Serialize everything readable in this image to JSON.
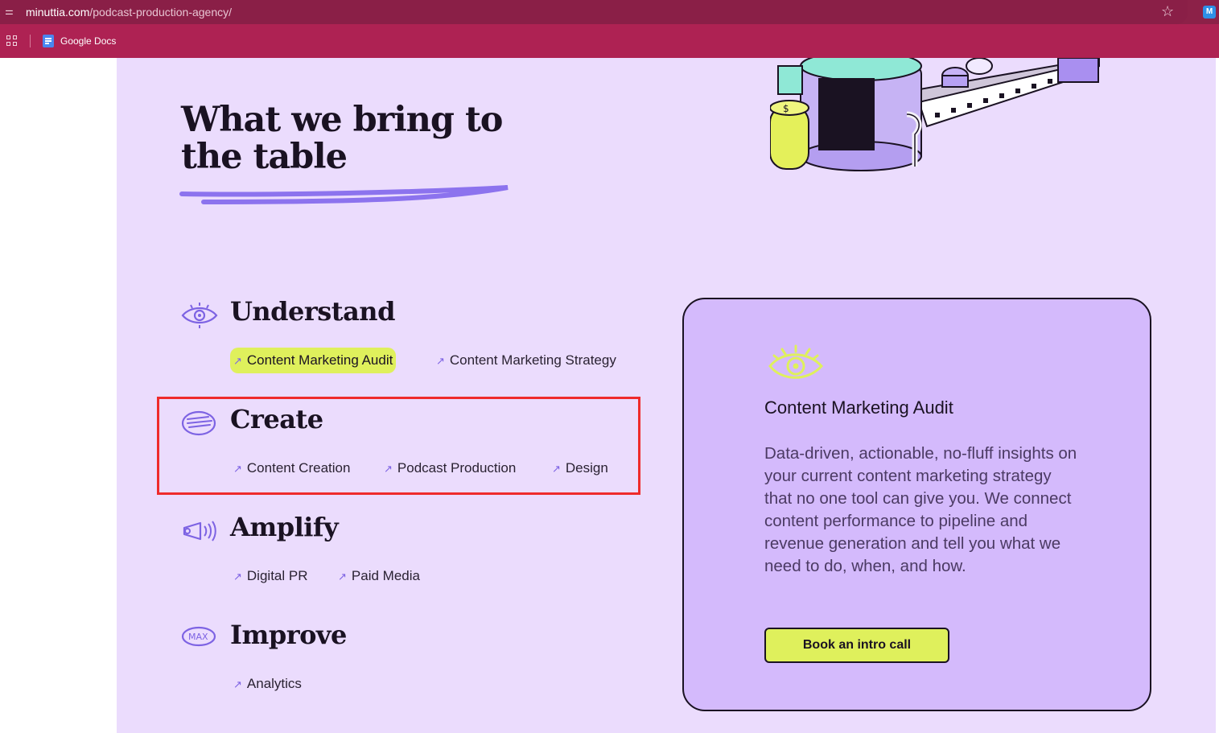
{
  "browser": {
    "url_domain": "minuttia.com",
    "url_path": "/podcast-production-agency/",
    "bookmark": "Google Docs",
    "extension_letter": "M"
  },
  "page": {
    "headline": "What we bring to the table",
    "services": [
      {
        "title": "Understand",
        "icon": "eye-icon",
        "links": [
          "Content Marketing Audit",
          "Content Marketing Strategy"
        ],
        "active_link": "Content Marketing Audit"
      },
      {
        "title": "Create",
        "icon": "pen-lines-icon",
        "links": [
          "Content Creation",
          "Podcast Production",
          "Design"
        ]
      },
      {
        "title": "Amplify",
        "icon": "megaphone-icon",
        "links": [
          "Digital PR",
          "Paid Media"
        ]
      },
      {
        "title": "Improve",
        "icon": "max-badge-icon",
        "links": [
          "Analytics"
        ]
      }
    ],
    "card": {
      "icon": "eye-icon",
      "title": "Content Marketing Audit",
      "description": "Data-driven, actionable, no-fluff insights on your current content marketing strategy that no one tool can give you. We connect content performance to pipeline and revenue generation and tell you what we need to do, when, and how.",
      "button": "Book an intro call"
    }
  },
  "colors": {
    "page_bg": "#ebdcfd",
    "accent_lime": "#dff05c",
    "accent_purple": "#7d63e3",
    "card_bg": "#d4bafc",
    "chrome": "#ae2253",
    "annotation_red": "#ef2b2b"
  }
}
